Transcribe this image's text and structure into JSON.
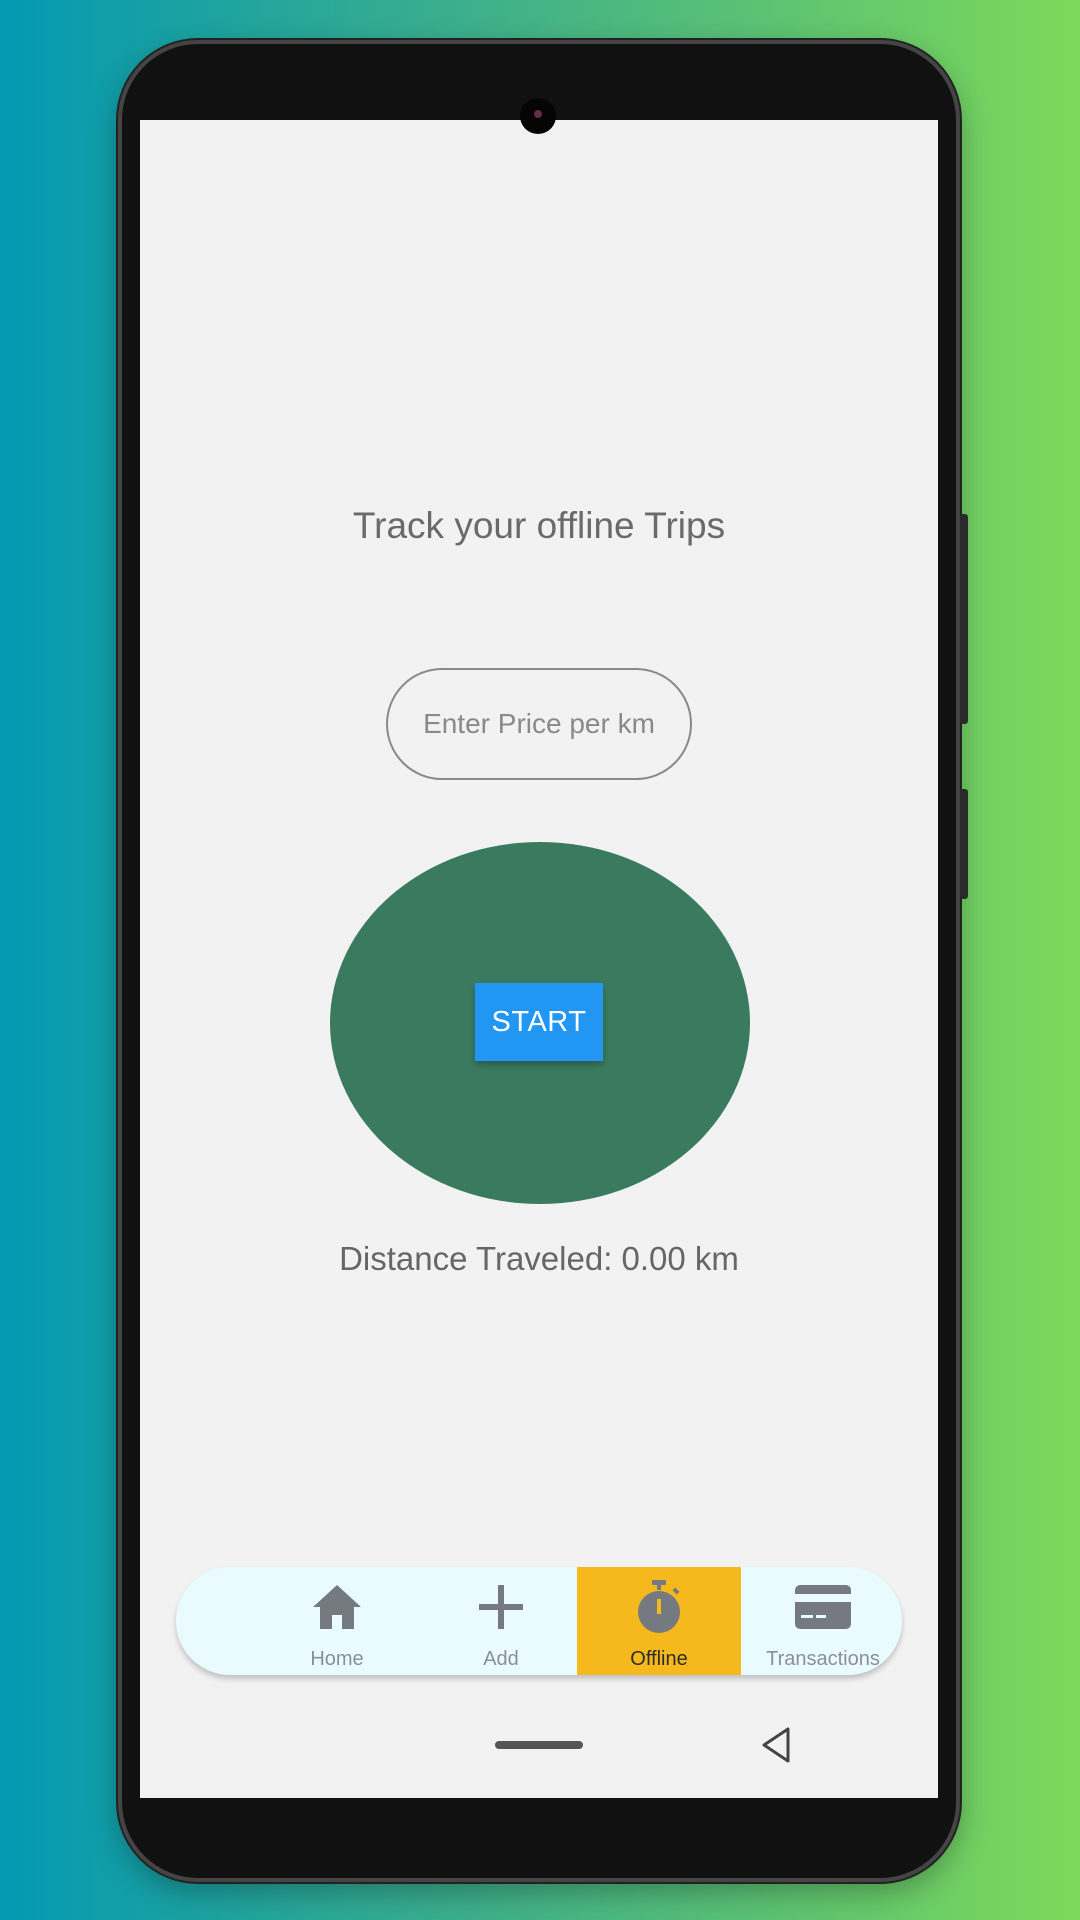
{
  "screen": {
    "title": "Track your offline Trips",
    "price_input": {
      "placeholder": "Enter Price per km",
      "value": ""
    },
    "start_button_label": "START",
    "distance_text": "Distance Traveled: 0.00 km"
  },
  "bottom_nav": {
    "items": [
      {
        "label": "Home",
        "icon": "home-icon",
        "active": false
      },
      {
        "label": "Add",
        "icon": "plus-icon",
        "active": false
      },
      {
        "label": "Offline",
        "icon": "stopwatch-icon",
        "active": true
      },
      {
        "label": "Transactions",
        "icon": "credit-card-icon",
        "active": false
      }
    ]
  },
  "colors": {
    "circle": "#3a7b60",
    "start_button": "#2196f3",
    "active_tab": "#f5b91e",
    "nav_background": "#eafbff",
    "screen_background": "#f2f2f2"
  }
}
